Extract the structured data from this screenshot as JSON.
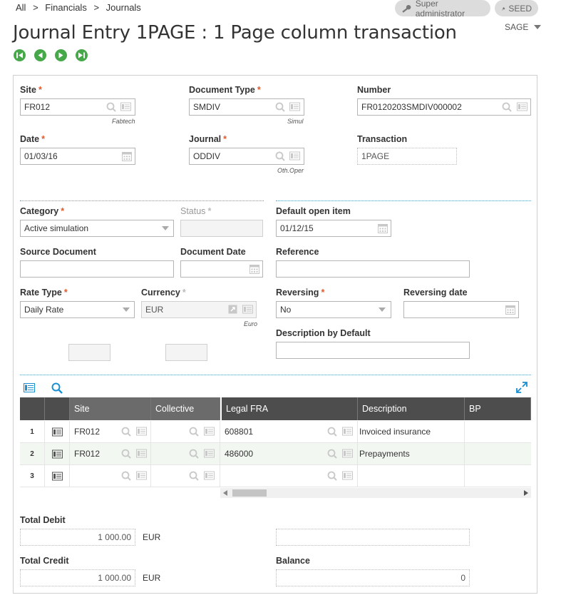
{
  "breadcrumb": {
    "all": "All",
    "sep": ">",
    "financials": "Financials",
    "journals": "Journals"
  },
  "header": {
    "user": "Super administrator",
    "folder": "SEED",
    "title": "Journal Entry 1PAGE : 1 Page column transaction",
    "sage_menu": "SAGE"
  },
  "fields": {
    "site": {
      "label": "Site",
      "value": "FR012",
      "sub": "Fabtech"
    },
    "document_type": {
      "label": "Document Type",
      "value": "SMDIV",
      "sub": "Simul"
    },
    "number": {
      "label": "Number",
      "value": "FR0120203SMDIV000002"
    },
    "date": {
      "label": "Date",
      "value": "01/03/16"
    },
    "journal": {
      "label": "Journal",
      "value": "ODDIV",
      "sub": "Oth.Oper"
    },
    "transaction": {
      "label": "Transaction",
      "value": "1PAGE"
    },
    "category": {
      "label": "Category",
      "value": "Active simulation"
    },
    "status": {
      "label": "Status",
      "value": ""
    },
    "default_open_item": {
      "label": "Default open item",
      "value": "01/12/15"
    },
    "source_document": {
      "label": "Source Document",
      "value": ""
    },
    "document_date": {
      "label": "Document Date",
      "value": ""
    },
    "reference": {
      "label": "Reference",
      "value": ""
    },
    "rate_type": {
      "label": "Rate Type",
      "value": "Daily Rate"
    },
    "currency": {
      "label": "Currency",
      "value": "EUR",
      "sub": "Euro"
    },
    "reversing": {
      "label": "Reversing",
      "value": "No"
    },
    "reversing_date": {
      "label": "Reversing date",
      "value": ""
    },
    "description_default": {
      "label": "Description by Default",
      "value": ""
    }
  },
  "grid": {
    "columns": [
      "Site",
      "Collective",
      "Legal FRA",
      "Description",
      "BP"
    ],
    "rows": [
      {
        "num": "1",
        "site": "FR012",
        "collective": "",
        "legal": "608801",
        "description": "Invoiced insurance",
        "bp": ""
      },
      {
        "num": "2",
        "site": "FR012",
        "collective": "",
        "legal": "486000",
        "description": "Prepayments",
        "bp": ""
      },
      {
        "num": "3",
        "site": "",
        "collective": "",
        "legal": "",
        "description": "",
        "bp": ""
      }
    ]
  },
  "totals": {
    "debit": {
      "label": "Total Debit",
      "value": "1 000.00",
      "currency": "EUR"
    },
    "credit": {
      "label": "Total Credit",
      "value": "1 000.00",
      "currency": "EUR"
    },
    "balance": {
      "label": "Balance",
      "value": "0"
    }
  },
  "colors": {
    "accent_green": "#47a849",
    "required_star": "#e05a2b",
    "link_blue": "#1a8fd1",
    "grid_header": "#4d4d4d"
  }
}
